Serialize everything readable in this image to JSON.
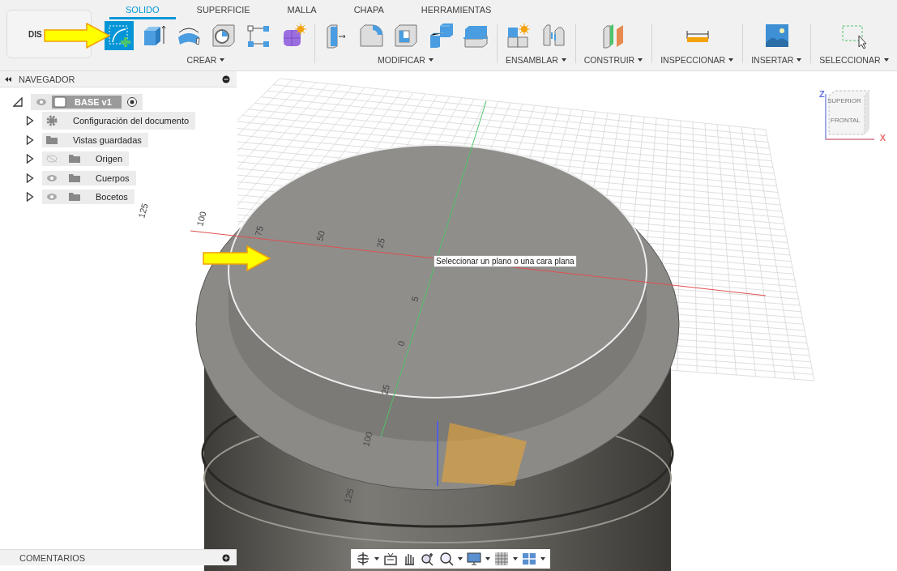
{
  "toolbar": {
    "workspace_button": "DIS",
    "tabs": [
      {
        "label": "SOLIDO",
        "selected": true
      },
      {
        "label": "SUPERFICIE",
        "selected": false
      },
      {
        "label": "MALLA",
        "selected": false
      },
      {
        "label": "CHAPA",
        "selected": false
      },
      {
        "label": "HERRAMIENTAS",
        "selected": false
      }
    ],
    "groups": [
      {
        "label": "CREAR",
        "tools": [
          {
            "kind": "sketch",
            "selected": true
          },
          {
            "kind": "extrude",
            "selected": false
          },
          {
            "kind": "revolve",
            "selected": false
          },
          {
            "kind": "hole",
            "selected": false
          },
          {
            "kind": "pattern",
            "selected": false
          },
          {
            "kind": "form",
            "selected": false
          }
        ]
      },
      {
        "label": "MODIFICAR",
        "tools": [
          {
            "kind": "press-pull",
            "selected": false
          },
          {
            "kind": "fillet",
            "selected": false
          },
          {
            "kind": "shell",
            "selected": false
          },
          {
            "kind": "combine",
            "selected": false
          },
          {
            "kind": "split",
            "selected": false
          }
        ]
      },
      {
        "label": "ENSAMBLAR",
        "tools": [
          {
            "kind": "component",
            "selected": false
          },
          {
            "kind": "joint",
            "selected": false
          }
        ]
      },
      {
        "label": "CONSTRUIR",
        "tools": [
          {
            "kind": "plane",
            "selected": false
          }
        ]
      },
      {
        "label": "INSPECCIONAR",
        "tools": [
          {
            "kind": "measure",
            "selected": false
          }
        ]
      },
      {
        "label": "INSERTAR",
        "tools": [
          {
            "kind": "image",
            "selected": false
          }
        ]
      },
      {
        "label": "SELECCIONAR",
        "tools": [
          {
            "kind": "select",
            "selected": false
          }
        ]
      }
    ]
  },
  "browser": {
    "title": "NAVEGADOR",
    "root": {
      "label": "BASE v1",
      "expanded": true,
      "children": [
        {
          "label": "Configuración del documento",
          "kind": "settings",
          "expanded": false
        },
        {
          "label": "Vistas guardadas",
          "kind": "folder",
          "expanded": false
        },
        {
          "label": "Origen",
          "kind": "folder",
          "expanded": false,
          "visible": false
        },
        {
          "label": "Cuerpos",
          "kind": "folder",
          "expanded": false,
          "visible": true
        },
        {
          "label": "Bocetos",
          "kind": "folder",
          "expanded": false,
          "visible": true
        }
      ]
    }
  },
  "viewport": {
    "tooltip": "Seleccionar un plano o una cara plana",
    "labels": [
      "125",
      "100",
      "75",
      "50",
      "25",
      "5",
      "0",
      "25",
      "100",
      "125"
    ]
  },
  "view_cube": {
    "top_face": "SUPERIOR",
    "front_face": "FRONTAL",
    "z_axis": "Z",
    "x_axis": "X"
  },
  "comments": {
    "title": "COMENTARIOS"
  }
}
